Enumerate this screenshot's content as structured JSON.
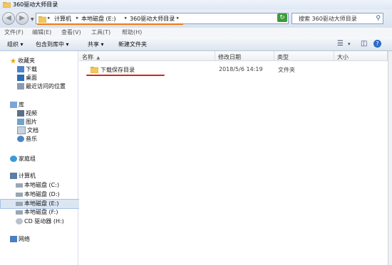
{
  "window": {
    "title": "360驱动大师目录"
  },
  "address": {
    "crumbs": [
      "计算机",
      "本地磁盘 (E:)",
      "360驱动大师目录"
    ]
  },
  "search": {
    "placeholder": "搜索 360驱动大师目录"
  },
  "menu": [
    "文件(F)",
    "编辑(E)",
    "查看(V)",
    "工具(T)",
    "帮助(H)"
  ],
  "toolbar": {
    "organize": "组织",
    "include": "包含到库中",
    "share": "共享",
    "new_folder": "新建文件夹"
  },
  "sidebar": {
    "favorites": "收藏夹",
    "fav_items": [
      "下载",
      "桌面",
      "最近访问的位置"
    ],
    "libraries": "库",
    "lib_items": [
      "视频",
      "图片",
      "文档",
      "音乐"
    ],
    "homegroup": "家庭组",
    "computer": "计算机",
    "drives": [
      "本地磁盘 (C:)",
      "本地磁盘 (D:)",
      "本地磁盘 (E:)",
      "本地磁盘 (F:)",
      "CD 驱动器 (H:)"
    ],
    "selected_drive_index": 2,
    "network": "网络"
  },
  "columns": [
    "名称",
    "修改日期",
    "类型",
    "大小"
  ],
  "files": [
    {
      "name": "下载保存目录",
      "modified": "2018/5/6 14:19",
      "type": "文件夹",
      "size": ""
    }
  ],
  "colors": {
    "highlight_orange": "#f07a10",
    "highlight_red": "#e0201e",
    "folder": "#f2c75c"
  },
  "icons": [
    "folder-icon",
    "back-icon",
    "forward-icon",
    "refresh-icon",
    "search-icon",
    "star-icon",
    "library-icon",
    "homegroup-icon",
    "computer-icon",
    "drive-icon",
    "cd-icon",
    "network-icon",
    "help-icon",
    "views-icon",
    "preview-pane-icon"
  ]
}
